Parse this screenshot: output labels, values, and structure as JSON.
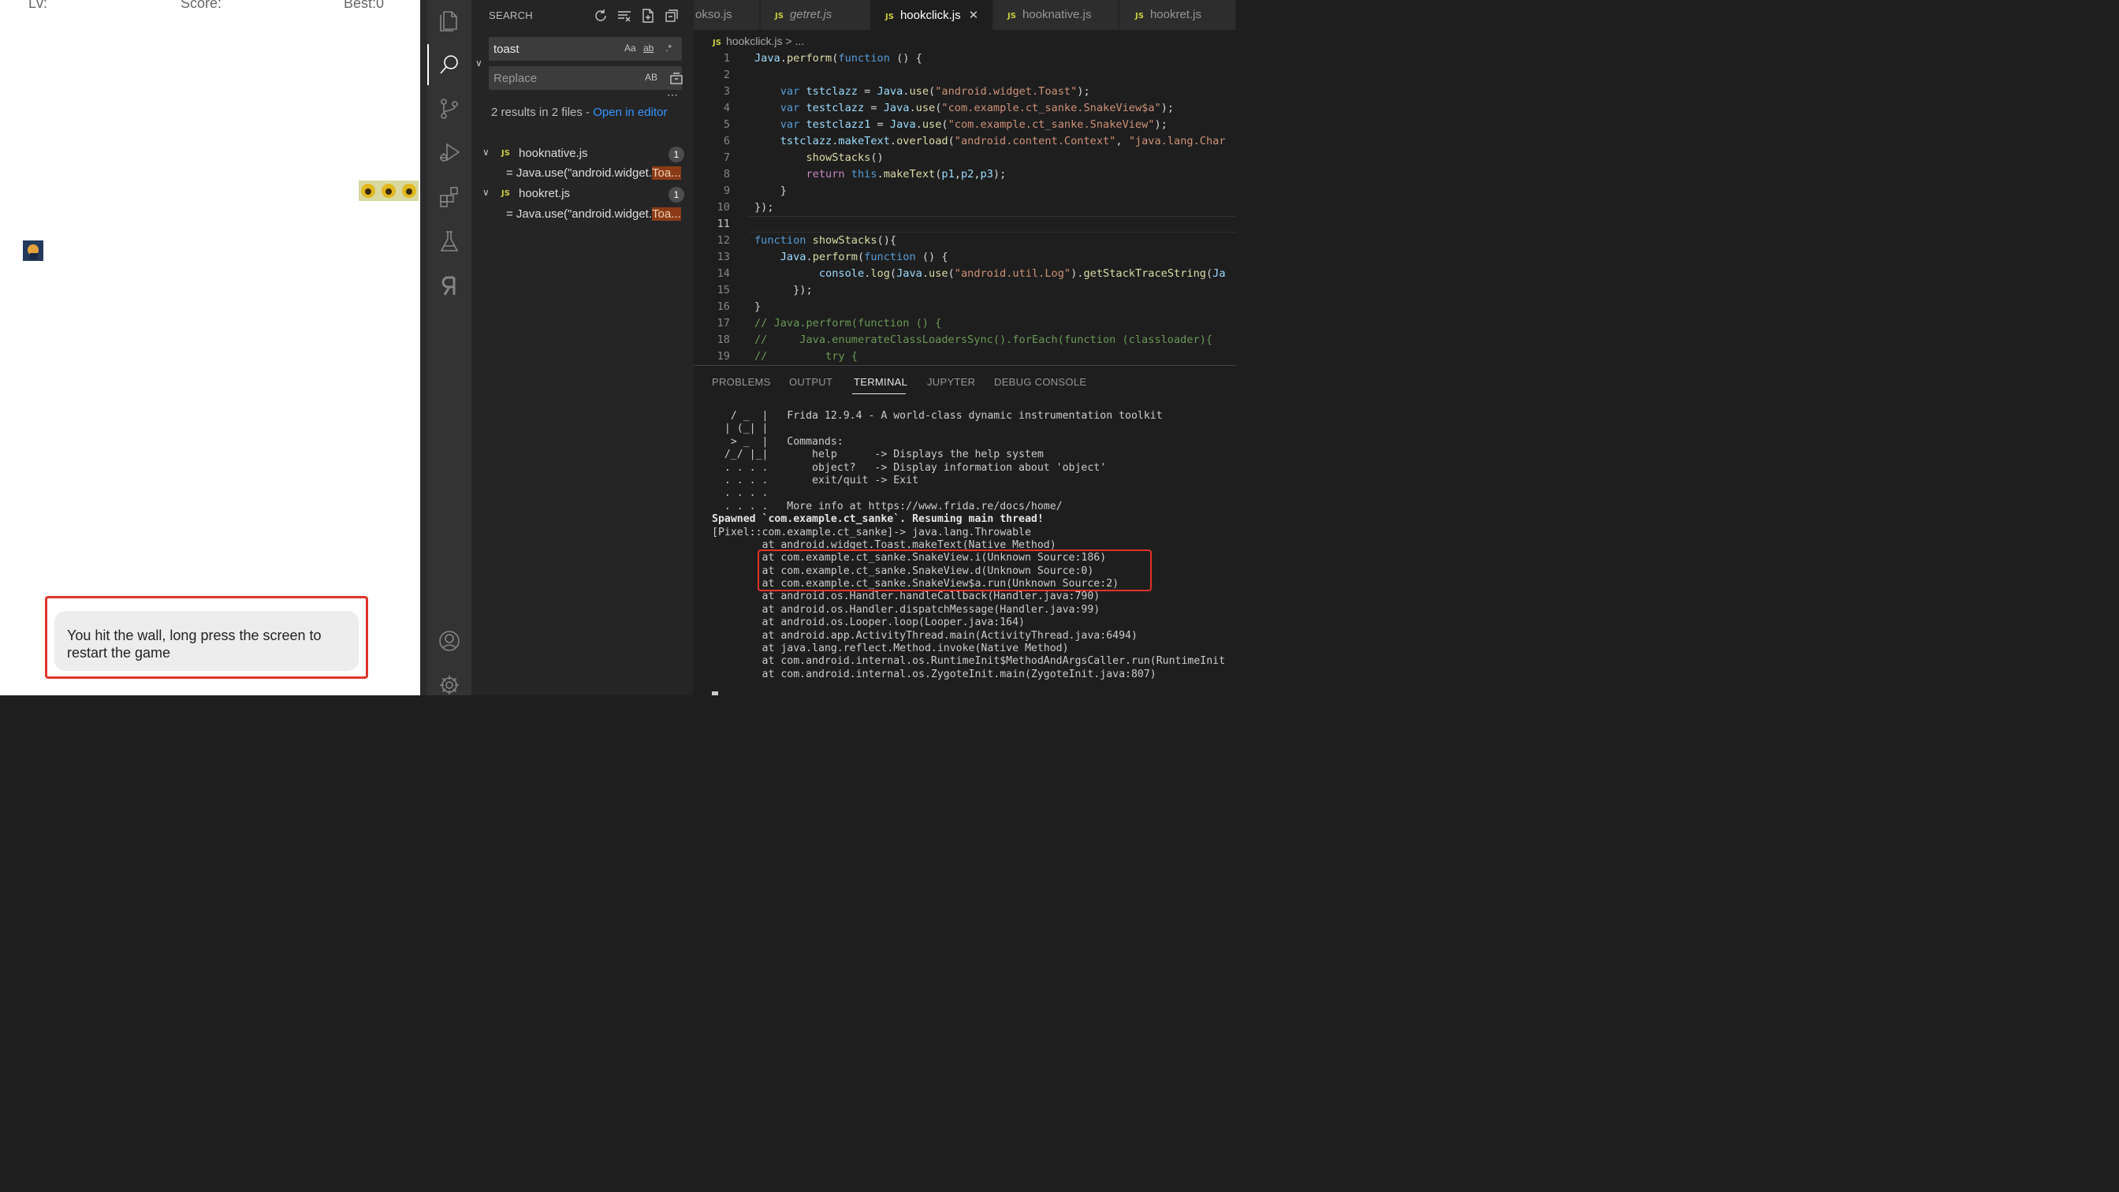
{
  "phone": {
    "hud_lv": "Lv:",
    "hud_score": "Score:",
    "hud_best": "Best:0",
    "toast": "You hit the wall, long press the screen to restart the game"
  },
  "activity_bar": {
    "icons": [
      "files-icon",
      "search-icon",
      "source-control-icon",
      "run-debug-icon",
      "extensions-icon",
      "testing-icon",
      "remote-icon",
      "account-icon",
      "settings-gear-icon"
    ]
  },
  "search": {
    "title": "SEARCH",
    "query": "toast",
    "replace_placeholder": "Replace",
    "opt_case": "Aa",
    "opt_word": "ab",
    "opt_regex": ".*",
    "opt_preserve": "AB",
    "summary": "2 results in 2 files - ",
    "open_editor": "Open in editor",
    "results": [
      {
        "file": "hooknative.js",
        "count": "1",
        "match_prefix": "= Java.use(\"android.widget.",
        "match_hl": "Toa..."
      },
      {
        "file": "hookret.js",
        "count": "1",
        "match_prefix": "= Java.use(\"android.widget.",
        "match_hl": "Toa..."
      }
    ]
  },
  "editor": {
    "tabs": [
      "okso.js",
      "getret.js",
      "hookclick.js",
      "hooknative.js",
      "hookret.js"
    ],
    "active_tab": "hookclick.js",
    "breadcrumb": "hookclick.js > ...",
    "current_line": 11
  },
  "panel": {
    "tabs": [
      "PROBLEMS",
      "OUTPUT",
      "TERMINAL",
      "JUPYTER",
      "DEBUG CONSOLE"
    ],
    "active_tab": "TERMINAL",
    "terminal_lines": [
      {
        "t": "   / _  |   Frida 12.9.4 - A world-class dynamic instrumentation toolkit",
        "b": false
      },
      {
        "t": "  | (_| |",
        "b": false
      },
      {
        "t": "   > _  |   Commands:",
        "b": false
      },
      {
        "t": "  /_/ |_|       help      -> Displays the help system",
        "b": false
      },
      {
        "t": "  . . . .       object?   -> Display information about 'object'",
        "b": false
      },
      {
        "t": "  . . . .       exit/quit -> Exit",
        "b": false
      },
      {
        "t": "  . . . .",
        "b": false
      },
      {
        "t": "  . . . .   More info at https://www.frida.re/docs/home/",
        "b": false
      },
      {
        "t": "Spawned `com.example.ct_sanke`. Resuming main thread!",
        "b": true
      },
      {
        "t": "[Pixel::com.example.ct_sanke]-> java.lang.Throwable",
        "b": false
      },
      {
        "t": "        at android.widget.Toast.makeText(Native Method)",
        "b": false
      },
      {
        "t": "        at com.example.ct_sanke.SnakeView.i(Unknown Source:186)",
        "b": false
      },
      {
        "t": "        at com.example.ct_sanke.SnakeView.d(Unknown Source:0)",
        "b": false
      },
      {
        "t": "        at com.example.ct_sanke.SnakeView$a.run(Unknown Source:2)",
        "b": false
      },
      {
        "t": "        at android.os.Handler.handleCallback(Handler.java:790)",
        "b": false
      },
      {
        "t": "        at android.os.Handler.dispatchMessage(Handler.java:99)",
        "b": false
      },
      {
        "t": "        at android.os.Looper.loop(Looper.java:164)",
        "b": false
      },
      {
        "t": "        at android.app.ActivityThread.main(ActivityThread.java:6494)",
        "b": false
      },
      {
        "t": "        at java.lang.reflect.Method.invoke(Native Method)",
        "b": false
      },
      {
        "t": "        at com.android.internal.os.RuntimeInit$MethodAndArgsCaller.run(RuntimeInit",
        "b": false
      },
      {
        "t": "        at com.android.internal.os.ZygoteInit.main(ZygoteInit.java:807)",
        "b": false
      }
    ]
  },
  "colors": {
    "highlight_border": "#e0332a",
    "link": "#3794ff",
    "js_badge": "#cbcb41"
  }
}
